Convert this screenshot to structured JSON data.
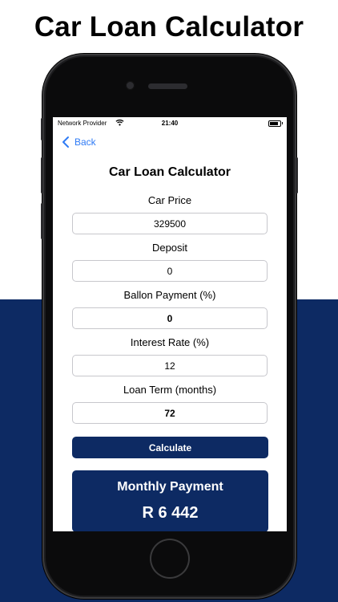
{
  "promo": {
    "title": "Car Loan Calculator"
  },
  "colors": {
    "brand_navy": "#0d2a63",
    "link_blue": "#2f7bf5"
  },
  "status_bar": {
    "carrier": "Network Provider",
    "time": "21:40",
    "wifi_icon": "wifi-icon",
    "battery_icon": "battery-icon"
  },
  "nav": {
    "back_label": "Back",
    "back_icon": "chevron-left-icon"
  },
  "screen": {
    "title": "Car Loan Calculator",
    "fields": [
      {
        "label": "Car Price",
        "value": "329500"
      },
      {
        "label": "Deposit",
        "value": "0"
      },
      {
        "label": "Ballon Payment (%)",
        "value": "0"
      },
      {
        "label": "Interest Rate (%)",
        "value": "12"
      },
      {
        "label": "Loan Term (months)",
        "value": "72"
      }
    ],
    "calculate_label": "Calculate",
    "result": {
      "label": "Monthly Payment",
      "value": "R 6 442"
    }
  }
}
